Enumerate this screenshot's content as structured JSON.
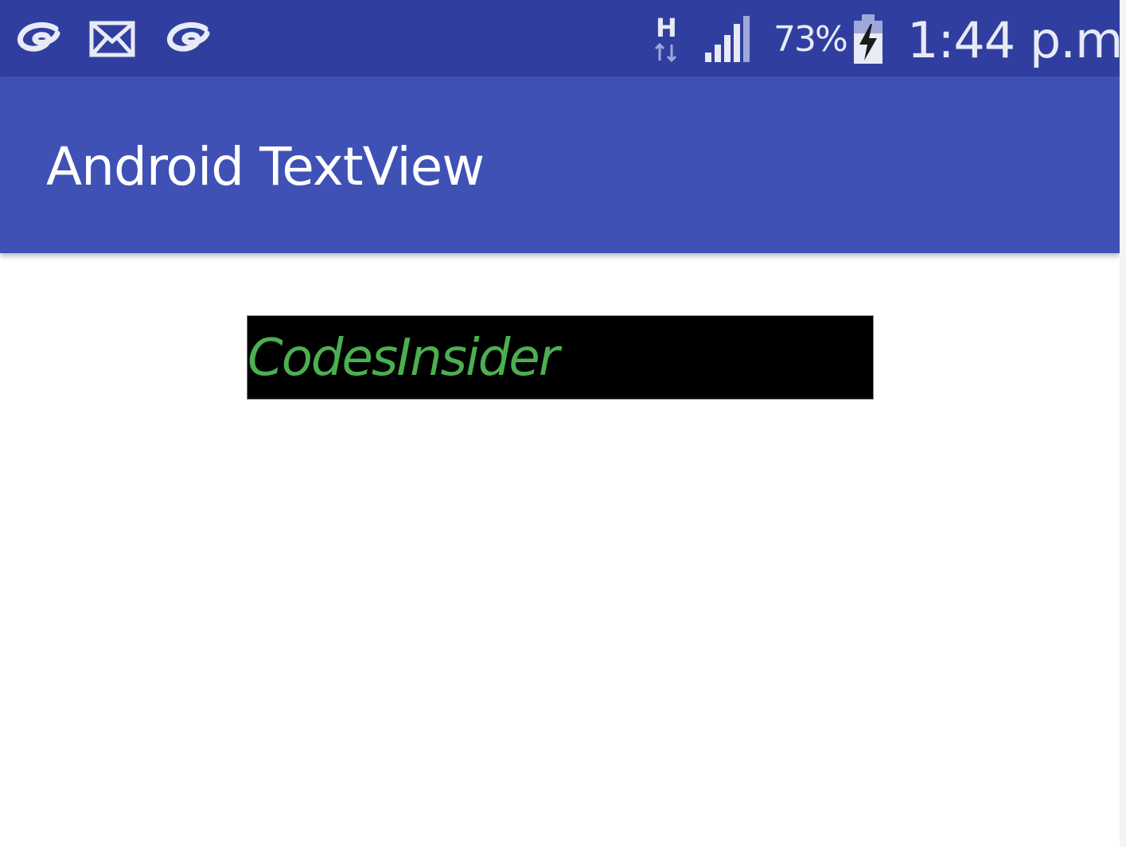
{
  "status_bar": {
    "notification_icons": [
      "swirl-icon",
      "mail-icon",
      "swirl-icon"
    ],
    "network_type": "H",
    "signal_icon": "signal-icon",
    "battery_percent": "73%",
    "battery_icon": "battery-charging-icon",
    "time": "1:44 p.m.",
    "color": "#303f9f"
  },
  "app_bar": {
    "title": "Android TextView",
    "color": "#3f51b5"
  },
  "main": {
    "textview": {
      "text": "CodesInsider",
      "text_color": "#4caf50",
      "background_color": "#000000"
    }
  }
}
